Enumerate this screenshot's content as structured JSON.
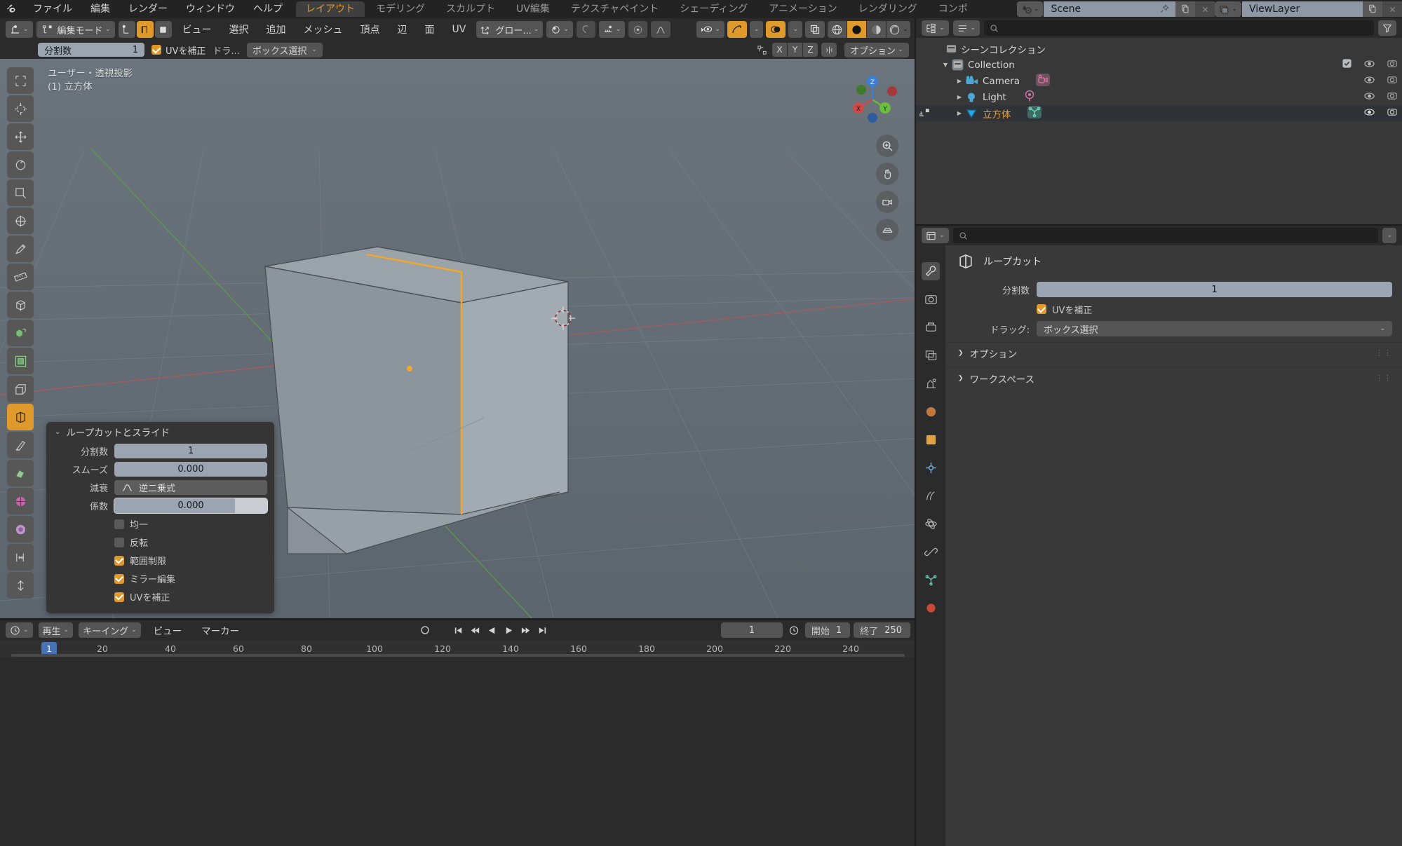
{
  "app": {
    "name": "Blender",
    "logo_icon": "blender-logo-icon"
  },
  "topbar": {
    "menus": [
      "ファイル",
      "編集",
      "レンダー",
      "ウィンドウ",
      "ヘルプ"
    ],
    "workspace_tabs": [
      {
        "label": "レイアウト",
        "active": true
      },
      {
        "label": "モデリング",
        "active": false
      },
      {
        "label": "スカルプト",
        "active": false
      },
      {
        "label": "UV編集",
        "active": false
      },
      {
        "label": "テクスチャペイント",
        "active": false
      },
      {
        "label": "シェーディング",
        "active": false
      },
      {
        "label": "アニメーション",
        "active": false
      },
      {
        "label": "レンダリング",
        "active": false
      },
      {
        "label": "コンポ",
        "active": false
      }
    ],
    "scene_name": "Scene",
    "viewlayer_name": "ViewLayer",
    "scene_icon": "scene-icon",
    "viewlayer_icon": "viewlayer-icon",
    "pin_icon": "pin-icon",
    "new_icon": "new-copy-icon",
    "close_icon": "close-x-icon"
  },
  "viewport_header": {
    "editor_type_icon": "editor-type-3dview-icon",
    "mode": "編集モード",
    "mode_icon": "edit-mode-icon",
    "select_modes": [
      {
        "name": "vertex-select-mode",
        "active": false
      },
      {
        "name": "edge-select-mode",
        "active": true
      },
      {
        "name": "face-select-mode",
        "active": false
      }
    ],
    "menus": [
      "ビュー",
      "選択",
      "追加",
      "メッシュ",
      "頂点",
      "辺",
      "面",
      "UV"
    ],
    "transform_orientation": "グロー...",
    "snap_icon": "magnet-icon",
    "proportional_icon": "proportional-edit-icon",
    "falloff_icon": "falloff-curve-icon",
    "pivot_icon": "pivot-point-icon",
    "xray_icon": "xray-toggle-icon",
    "visibility_icon": "visibility-eye-icon",
    "gizmo_icon": "gizmo-icon",
    "overlays_icon": "overlays-icon",
    "shading_modes": [
      {
        "name": "wireframe-shading",
        "active": false
      },
      {
        "name": "solid-shading",
        "active": true
      },
      {
        "name": "material-preview-shading",
        "active": false
      },
      {
        "name": "rendered-shading",
        "active": false
      }
    ]
  },
  "tool_settings": {
    "cuts_label": "分割数",
    "cuts_value": "1",
    "correct_uv_label": "UVを補正",
    "correct_uv_checked": true,
    "drag_label": "ドラ...",
    "drag_value": "ボックス選択",
    "snap_axis_icon": "snap-axis-icon",
    "axes": [
      "X",
      "Y",
      "Z"
    ],
    "mirror_icon": "mirror-icon",
    "options_label": "オプション"
  },
  "viewport": {
    "info_line1": "ユーザー・透視投影",
    "info_line2": "(1) 立方体",
    "gizmo_axes": [
      {
        "label": "X",
        "color": "#cc4a4a"
      },
      {
        "label": "Y",
        "color": "#6bbf3f"
      },
      {
        "label": "Z",
        "color": "#3b7fd4"
      }
    ],
    "nav_buttons": [
      "zoom-icon",
      "pan-hand-icon",
      "camera-view-icon",
      "ortho-persp-toggle-icon"
    ],
    "toolbar_tools": [
      {
        "name": "tweak-select-tool",
        "active": false
      },
      {
        "name": "cursor-tool",
        "active": false
      },
      {
        "name": "move-tool",
        "active": false
      },
      {
        "name": "rotate-tool",
        "active": false
      },
      {
        "name": "scale-tool",
        "active": false
      },
      {
        "name": "transform-tool",
        "active": false
      },
      {
        "name": "annotate-tool",
        "active": false
      },
      {
        "name": "measure-tool",
        "active": false
      },
      {
        "name": "add-cube-tool",
        "active": false
      },
      {
        "name": "extrude-region-tool",
        "active": false
      },
      {
        "name": "inset-faces-tool",
        "active": false
      },
      {
        "name": "bevel-tool",
        "active": false
      },
      {
        "name": "loop-cut-tool",
        "active": true
      },
      {
        "name": "knife-tool",
        "active": false
      },
      {
        "name": "poly-build-tool",
        "active": false
      },
      {
        "name": "spin-tool",
        "active": false
      },
      {
        "name": "smooth-tool",
        "active": false
      },
      {
        "name": "edge-slide-tool",
        "active": false
      },
      {
        "name": "shrink-fatten-tool",
        "active": false
      }
    ],
    "cube_object": "立方体",
    "edge_highlight_color": "#f5a623"
  },
  "operator_panel": {
    "title": "ループカットとスライド",
    "expanded": true,
    "fields": [
      {
        "label": "分割数",
        "value": "1",
        "type": "number"
      },
      {
        "label": "スムーズ",
        "value": "0.000",
        "type": "number"
      },
      {
        "label": "減衰",
        "value": "逆二乗式",
        "type": "dropdown",
        "icon": "falloff-curve-icon"
      },
      {
        "label": "係数",
        "value": "0.000",
        "type": "slider"
      }
    ],
    "checkboxes": [
      {
        "label": "均一",
        "checked": false
      },
      {
        "label": "反転",
        "checked": false
      },
      {
        "label": "範囲制限",
        "checked": true
      },
      {
        "label": "ミラー編集",
        "checked": true
      },
      {
        "label": "UVを補正",
        "checked": true
      }
    ]
  },
  "timeline": {
    "editor_icon": "timeline-editor-icon",
    "playback_label": "再生",
    "keying_label": "キーイング",
    "view_label": "ビュー",
    "marker_label": "マーカー",
    "record_icon": "record-icon",
    "transport": [
      "jump-to-start-icon",
      "prev-keyframe-icon",
      "play-reverse-icon",
      "play-icon",
      "next-keyframe-icon",
      "jump-to-end-icon"
    ],
    "current_frame": "1",
    "clock_icon": "auto-key-clock-icon",
    "start_label": "開始",
    "start_value": "1",
    "end_label": "終了",
    "end_value": "250",
    "ruler_ticks": [
      "20",
      "40",
      "60",
      "80",
      "100",
      "120",
      "140",
      "160",
      "180",
      "200",
      "220",
      "240"
    ],
    "playhead_label": "1"
  },
  "outliner": {
    "display_mode_icon": "outliner-display-mode-icon",
    "filter_icon": "filter-icon",
    "search_placeholder": "",
    "search_icon": "search-icon",
    "rows": [
      {
        "label": "シーンコレクション",
        "depth": 0,
        "icon": "collection-icon",
        "has_tri": false,
        "selected": false,
        "active": false,
        "show_checkbox": false,
        "show_eye": false,
        "show_camera": false
      },
      {
        "label": "Collection",
        "depth": 1,
        "icon": "collection-icon",
        "has_tri": true,
        "tri": "▼",
        "selected": false,
        "active": false,
        "show_checkbox": true,
        "show_eye": true,
        "show_camera": true
      },
      {
        "label": "Camera",
        "depth": 2,
        "icon": "camera-object-icon",
        "data_icon": "camera-data-icon",
        "has_tri": true,
        "tri": "▶",
        "selected": false,
        "active": false,
        "show_checkbox": false,
        "show_eye": true,
        "show_camera": true
      },
      {
        "label": "Light",
        "depth": 2,
        "icon": "light-object-icon",
        "data_icon": "light-data-icon",
        "has_tri": true,
        "tri": "▶",
        "selected": false,
        "active": false,
        "show_checkbox": false,
        "show_eye": true,
        "show_camera": true
      },
      {
        "label": "立方体",
        "depth": 2,
        "icon": "mesh-object-icon",
        "data_icon": "mesh-data-icon",
        "has_tri": true,
        "tri": "▶",
        "selected": true,
        "active": true,
        "show_checkbox": false,
        "show_eye": true,
        "show_camera": true
      }
    ]
  },
  "properties": {
    "editor_icon": "properties-editor-icon",
    "search_placeholder": "",
    "tool_title": "ループカット",
    "tool_icon": "loop-cut-tool-icon",
    "fields": [
      {
        "label": "分割数",
        "value": "1",
        "type": "number"
      }
    ],
    "checkbox": {
      "label": "UVを補正",
      "checked": true
    },
    "dropdown": {
      "label": "ドラッグ:",
      "value": "ボックス選択"
    },
    "sections": [
      {
        "label": "オプション",
        "expanded": false
      },
      {
        "label": "ワークスペース",
        "expanded": false
      }
    ],
    "tabs": [
      {
        "name": "tool-properties-tab",
        "active": true
      },
      {
        "name": "render-properties-tab",
        "active": false
      },
      {
        "name": "output-properties-tab",
        "active": false
      },
      {
        "name": "viewlayer-properties-tab",
        "active": false
      },
      {
        "name": "scene-properties-tab",
        "active": false
      },
      {
        "name": "world-properties-tab",
        "active": false
      },
      {
        "name": "object-properties-tab",
        "active": false
      },
      {
        "name": "modifier-properties-tab",
        "active": false
      },
      {
        "name": "particles-properties-tab",
        "active": false
      },
      {
        "name": "physics-properties-tab",
        "active": false
      },
      {
        "name": "constraints-properties-tab",
        "active": false
      },
      {
        "name": "data-properties-tab",
        "active": false
      },
      {
        "name": "material-properties-tab",
        "active": false
      }
    ]
  },
  "colors": {
    "accent": "#e09a2b",
    "panel_bg": "#353535",
    "header_bg": "#2b2b2b",
    "field_bg": "#9aa5b1",
    "viewport_bg": "#646d75",
    "selection_blue": "#4772b3"
  }
}
